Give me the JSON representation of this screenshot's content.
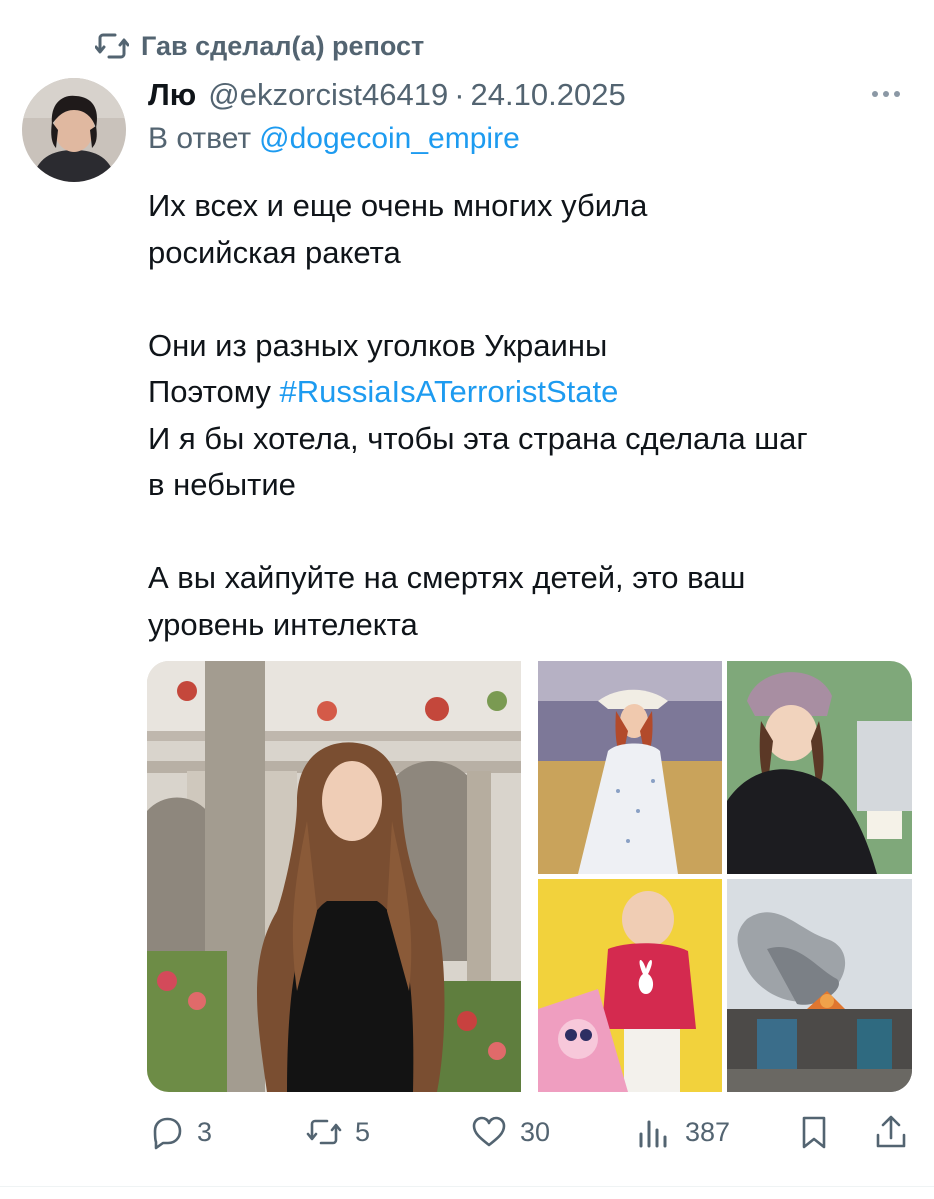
{
  "repost": {
    "text": "Гав сделал(а) репост",
    "icon": "repost-icon"
  },
  "tweet": {
    "author_name": "Лю",
    "handle": "@ekzorcist46419",
    "separator": "·",
    "date": "24.10.2025",
    "reply_prefix": "В ответ",
    "reply_mention": "@dogecoin_empire",
    "lines": {
      "l1": "Их всех и еще очень многих убила",
      "l2": "росийская ракета",
      "l3": "Они из разных уголков Украины",
      "l4_prefix": "Поэтому ",
      "l4_hashtag": "#RussiaIsATerroristState",
      "l5": "И я бы хотела, чтобы эта страна сделала шаг",
      "l6": "в небытие",
      "l7": "А вы хайпуйте на смертях детей, это ваш",
      "l8": "уровень интелекта"
    }
  },
  "media": {
    "tiles": [
      "girl-in-courtyard-photo",
      "woman-in-lavender-field-photo",
      "girl-in-knit-hat-photo",
      "baby-on-yellow-blanket-photo",
      "burning-house-photo"
    ]
  },
  "actions": {
    "replies": "3",
    "reposts": "5",
    "likes": "30",
    "views": "387"
  },
  "colors": {
    "text": "#0f1419",
    "secondary": "#536471",
    "link": "#1d9bf0"
  }
}
